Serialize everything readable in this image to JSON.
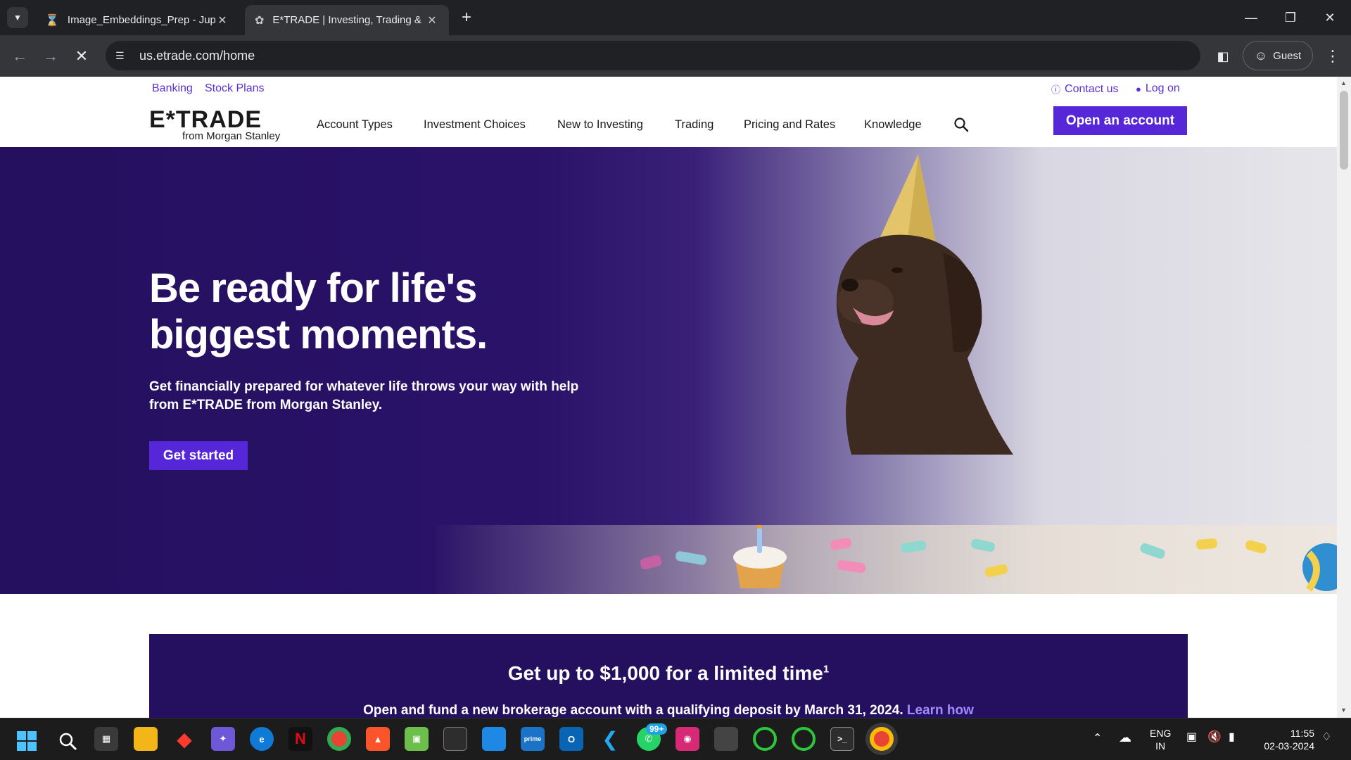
{
  "browser": {
    "tabs": [
      {
        "title": "Image_Embeddings_Prep - Jupyter",
        "active": false
      },
      {
        "title": "E*TRADE | Investing, Trading & Retirement",
        "active": true
      }
    ],
    "url": "us.etrade.com/home",
    "profile_label": "Guest"
  },
  "site": {
    "util_left": [
      "Banking",
      "Stock Plans"
    ],
    "contact_label": "Contact us",
    "login_label": "Log on",
    "logo_text": "E*TRADE",
    "logo_sub": "from Morgan Stanley",
    "nav": [
      "Account Types",
      "Investment Choices",
      "New to Investing",
      "Trading",
      "Pricing and Rates",
      "Knowledge"
    ],
    "cta_label": "Open an account"
  },
  "hero": {
    "title_line1": "Be ready for life's",
    "title_line2": "biggest moments.",
    "subtitle": "Get financially prepared for whatever life throws your way with help from E*TRADE from Morgan Stanley.",
    "button_label": "Get started"
  },
  "promo": {
    "title": "Get up to $1,000 for a limited time",
    "title_sup": "1",
    "body": "Open and fund a new brokerage account with a qualifying deposit by March 31, 2024.",
    "link": "Learn how"
  },
  "taskbar": {
    "badge": "99+",
    "lang_line1": "ENG",
    "lang_line2": "IN",
    "time": "11:55",
    "date": "02-03-2024"
  },
  "colors": {
    "brand_purple": "#5627d8",
    "hero_dark": "#24105e"
  }
}
